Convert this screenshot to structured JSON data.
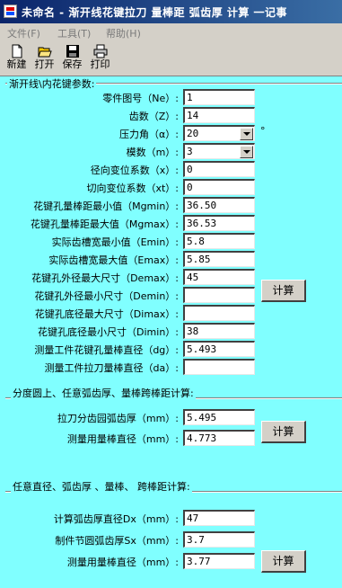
{
  "window": {
    "title": "未命名 - 渐开线花键拉刀 量棒距 弧齿厚 计算 一记事"
  },
  "menu": [
    {
      "label": "文件(F)"
    },
    {
      "label": "工具(T)"
    },
    {
      "label": "帮助(H)"
    }
  ],
  "toolbar": {
    "new_label": "新建",
    "open_label": "打开",
    "save_label": "保存",
    "print_label": "打印"
  },
  "section1": {
    "title": "渐开线\\内花键参数:",
    "rows": [
      {
        "label": "零件图号（Ne）:",
        "value": "1"
      },
      {
        "label": "齿数（Z）:",
        "value": "14"
      },
      {
        "label": "压力角（α）:",
        "value": "20"
      },
      {
        "label": "模数（m）:",
        "value": "3"
      },
      {
        "label": "径向变位系数（x）:",
        "value": "0"
      },
      {
        "label": "切向变位系数（xt）:",
        "value": "0"
      },
      {
        "label": "花键孔量棒距最小值（Mgmin）:",
        "value": "36.50"
      },
      {
        "label": "花键孔量棒距最大值（Mgmax）:",
        "value": "36.53"
      },
      {
        "label": "实际齿槽宽最小值（Emin）:",
        "value": "5.8"
      },
      {
        "label": "实际齿槽宽最大值（Emax）:",
        "value": "5.85"
      },
      {
        "label": "花键孔外径最大尺寸（Demax）:",
        "value": "45"
      },
      {
        "label": "花键孔外径最小尺寸（Demin）:",
        "value": ""
      },
      {
        "label": "花键孔底径最大尺寸（Dimax）:",
        "value": ""
      },
      {
        "label": "花键孔底径最小尺寸（Dimin）:",
        "value": "38"
      },
      {
        "label": "测量工件花键孔量棒直径（dg）:",
        "value": "5.493"
      },
      {
        "label": "测量工件拉刀量棒直径（da）:",
        "value": ""
      }
    ],
    "degree_unit": "°",
    "calc_label": "计算"
  },
  "section2": {
    "title": "分度圆上、任意弧齿厚、量棒跨棒距计算:",
    "rows": [
      {
        "label": "拉刀分齿园弧齿厚（mm）:",
        "value": "5.495"
      },
      {
        "label": "测量用量棒直径（mm）:",
        "value": "4.773"
      }
    ],
    "calc_label": "计算"
  },
  "section3": {
    "title": "任意直径、弧齿厚 、量棒、 跨棒距计算:",
    "rows": [
      {
        "label": "计算弧齿厚直径Dx（mm）:",
        "value": "47"
      },
      {
        "label": "制件节圆弧齿厚Sx（mm）:",
        "value": "3.7"
      },
      {
        "label": "测量用量棒直径（mm）:",
        "value": "3.77"
      }
    ],
    "calc_label": "计算"
  }
}
